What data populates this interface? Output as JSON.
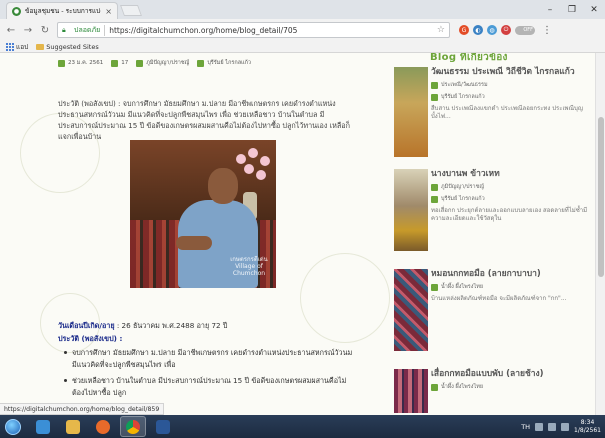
{
  "browser": {
    "tab_title": "ข้อมูลชุมชน - ระบบการแบ่งปันข้อมูล",
    "tab_close": "×",
    "window_buttons": [
      "–",
      "❐",
      "✕"
    ],
    "secure_label": "ปลอดภัย",
    "url": "https://digitalchumchon.org/home/blog_detail/705",
    "toggle_label": "OFF",
    "bookmarks": [
      {
        "label": "แอป"
      },
      {
        "label": "Suggested Sites"
      }
    ],
    "status_url": "https://digitalchumchon.org/home/blog_detail/859"
  },
  "article": {
    "meta": {
      "date": "23 ม.ค. 2561",
      "views": "17",
      "category": "ภูมิปัญญา/ปราชญ์",
      "author": "บุรีรัมย์ ไกรกลแก้ว"
    },
    "intro": "ประวัติ (พอสังเขป) : จบการศึกษา มัธยมศึกษา ม.ปลาย มีอาชีพเกษตรกร เคยดำรงตำแหน่งประธานสหกรณ์วัวนม มีแนวคิดที่จะปลูกพืชสมุนไพร เพื่อ ช่วยเหลือชาว บ้านในตำบล มีประสบการณ์ประมาณ 15 ปี ข้อดีของเกษตรผสมผสานคือไม่ต้องไปหาซื้อ ปลูกไว้ทานเอง เหลือก็แจกเพื่อนบ้าน",
    "photo_watermark_1": "เกษตรกรดีเด่น",
    "photo_watermark_2": "Village of Chumchon",
    "birth_label": "วันเดือนปีเกิด/อายุ",
    "birth_value": " : 26 ธันวาคม พ.ศ.2488 อายุ 72 ปี",
    "history_label": "ประวัติ (พอสังเขป) :",
    "bullets": [
      "จบการศึกษา มัธยมศึกษา ม.ปลาย มีอาชีพเกษตรกร เคยดำรงตำแหน่งประธานสหกรณ์วัวนม มีแนวคิดที่จะปลูกพืชสมุนไพร เพื่อ",
      "ช่วยเหลือชาว บ้านในตำบล มีประสบการณ์ประมาณ 15 ปี ข้อดีของเกษตรผสมผสานคือไม่ต้องไปหาซื้อ ปลูก"
    ]
  },
  "sidebar": {
    "heading": "Blog ที่เกี่ยวข้อง",
    "cards": [
      {
        "title": "วัฒนธรรม ประเพณี วิถีชีวิต ไกรกลแก้ว",
        "category": "ประเพณี/วัฒนธรรม",
        "author": "บุรีรัมย์ ไกรกลแก้ว",
        "desc": "สืบสาน ประเพณีลงแขกดำ ประเพณีลอยกระทง ประเพณีบุญบั้งไฟ..."
      },
      {
        "title": "นางบานพ ข้าวเหท",
        "category": "ภูมิปัญญา/ปราชญ์",
        "author": "บุรีรัมย์ ไกรกลแก้ว",
        "desc": "ทอเสื่อกก ประยุกต์ลายและออกแบบลายเอง สอดลายที่ไม่ซ้ำมีความละเอียดและใช้วัสดุใน"
      },
      {
        "title": "หมอนกกทอมือ (ลายกาบาบา)",
        "category": "น้ำผึ้ง ผึ้งไพรงไทย",
        "author": "",
        "desc": "บ้านแหล่งผลิตภัณฑ์ทอมือ จะมีผลิตภัณฑ์จาก \"กก\"..."
      },
      {
        "title": "เสื่อกกทอมือแบบพับ (ลายช้าง)",
        "category": "น้ำผึ้ง ผึ้งไพรงไทย",
        "author": "",
        "desc": ""
      }
    ]
  },
  "taskbar": {
    "lang": "TH",
    "time": "8:34",
    "date": "1/8/2561"
  },
  "colors": {
    "accent_green": "#6da53a",
    "secure_green": "#2e8b3c",
    "label_blue": "#1a2a8a",
    "taskbar": "#1c2b40"
  }
}
